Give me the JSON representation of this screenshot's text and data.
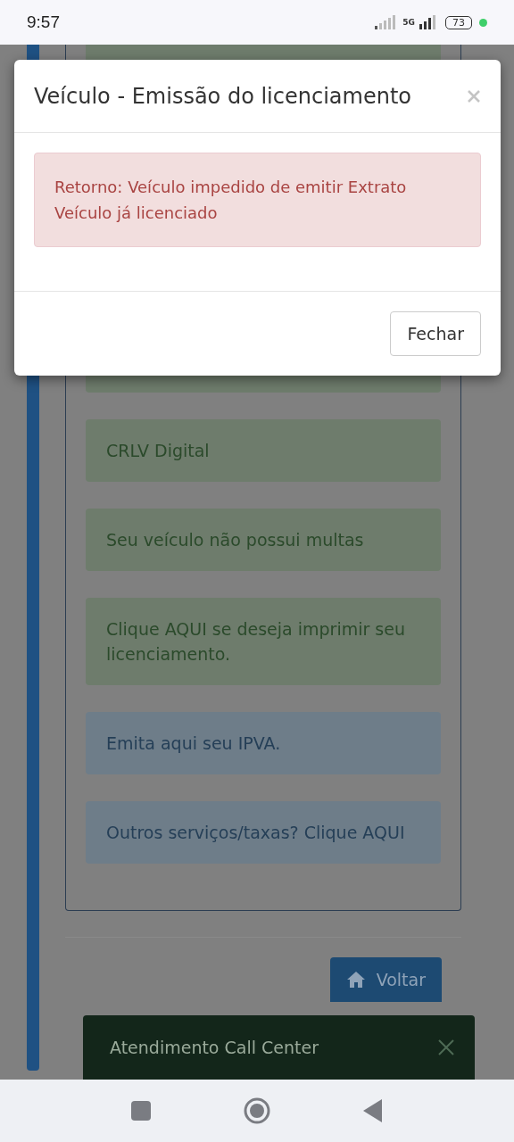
{
  "status_bar": {
    "time": "9:57",
    "network": "5G",
    "battery": "73"
  },
  "cards": [
    {
      "kind": "success",
      "text": "CRLV Digital"
    },
    {
      "kind": "success",
      "text": "Seu veículo não possui multas"
    },
    {
      "kind": "success",
      "text": "Clique AQUI se deseja imprimir seu licenciamento."
    },
    {
      "kind": "info",
      "text": "Emita aqui seu IPVA."
    },
    {
      "kind": "info",
      "text": "Outros serviços/taxas? Clique AQUI"
    }
  ],
  "back_button": "Voltar",
  "toast": {
    "text": "Atendimento Call Center"
  },
  "modal": {
    "title": "Veículo - Emissão do licenciamento",
    "alert": [
      "Retorno: Veículo impedido de emitir Extrato",
      "Veículo já licenciado"
    ],
    "buttons": [
      "Fechar"
    ]
  }
}
